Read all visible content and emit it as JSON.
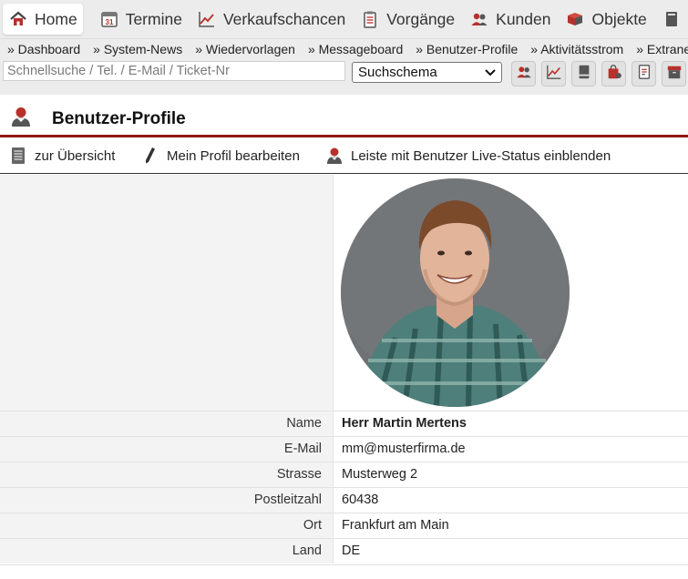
{
  "nav": {
    "tabs": [
      {
        "label": "Home",
        "icon": "home-icon"
      },
      {
        "label": "Termine",
        "icon": "calendar-icon"
      },
      {
        "label": "Verkaufschancen",
        "icon": "trend-chart-icon"
      },
      {
        "label": "Vorgänge",
        "icon": "clipboard-icon"
      },
      {
        "label": "Kunden",
        "icon": "customers-icon"
      },
      {
        "label": "Objekte",
        "icon": "objects-icon"
      },
      {
        "label": "",
        "icon": "document-icon"
      }
    ]
  },
  "subnav": {
    "links": [
      "» Dashboard",
      "» System-News",
      "» Wiedervorlagen",
      "» Messageboard",
      "» Benutzer-Profile",
      "» Aktivitätsstrom",
      "» Extranet"
    ]
  },
  "search": {
    "placeholder": "Schnellsuche / Tel. / E-Mail / Ticket-Nr",
    "schema_label": "Suchschema"
  },
  "toolbar": {
    "icons": [
      "customers-icon",
      "trend-chart-icon",
      "notebook-icon",
      "shopping-bag-icon",
      "document-list-icon",
      "archive-box-icon"
    ]
  },
  "page": {
    "title": "Benutzer-Profile"
  },
  "actions": [
    {
      "label": "zur Übersicht",
      "icon": "list-icon"
    },
    {
      "label": "Mein Profil bearbeiten",
      "icon": "pencil-icon"
    },
    {
      "label": "Leiste mit Benutzer Live-Status einblenden",
      "icon": "user-status-icon"
    }
  ],
  "profile": {
    "rows": [
      {
        "label": "Name",
        "value": "Herr Martin Mertens"
      },
      {
        "label": "E-Mail",
        "value": "mm@musterfirma.de"
      },
      {
        "label": "Strasse",
        "value": "Musterweg 2"
      },
      {
        "label": "Postleitzahl",
        "value": "60438"
      },
      {
        "label": "Ort",
        "value": "Frankfurt am Main"
      },
      {
        "label": "Land",
        "value": "DE"
      }
    ]
  },
  "colors": {
    "accent": "#8e1a12",
    "icon_red": "#b7302a",
    "panel_bg": "#f3f3f3",
    "nav_bg": "#ececec"
  }
}
